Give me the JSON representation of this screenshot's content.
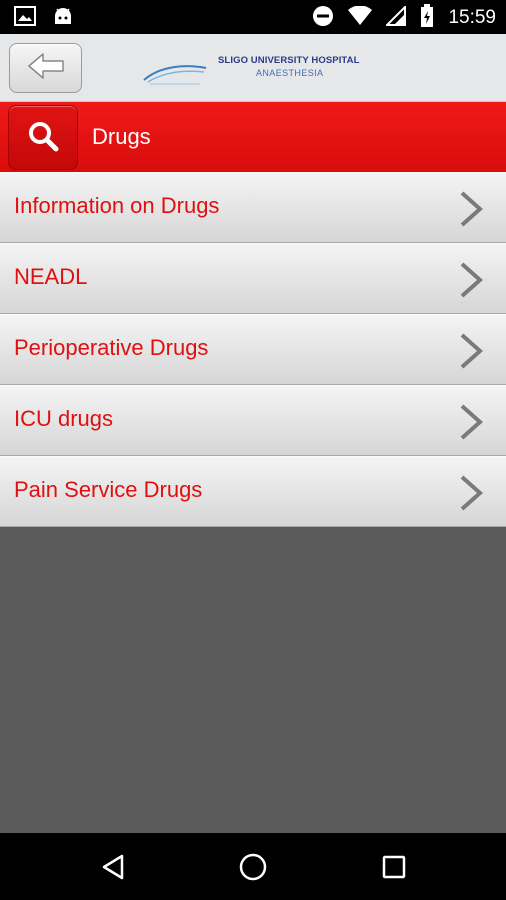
{
  "status_bar": {
    "time": "15:59",
    "icons": [
      "image-icon",
      "android-icon",
      "do-not-disturb-icon",
      "wifi-icon",
      "signal-icon",
      "battery-icon"
    ]
  },
  "header": {
    "back_icon": "arrow-left-icon",
    "logo": {
      "line1": "SLIGO UNIVERSITY HOSPITAL",
      "line2": "ANAESTHESIA"
    }
  },
  "title_bar": {
    "search_icon": "search-icon",
    "title": "Drugs"
  },
  "menu": {
    "items": [
      {
        "label": "Information on Drugs"
      },
      {
        "label": "NEADL"
      },
      {
        "label": "Perioperative Drugs"
      },
      {
        "label": "ICU drugs"
      },
      {
        "label": "Pain Service Drugs"
      }
    ]
  },
  "nav_bar": {
    "buttons": [
      "back-triangle-icon",
      "home-circle-icon",
      "recents-square-icon"
    ]
  },
  "colors": {
    "accent_red": "#e01010",
    "title_bar_red": "#e41212",
    "background_gray": "#5a5a5a"
  }
}
